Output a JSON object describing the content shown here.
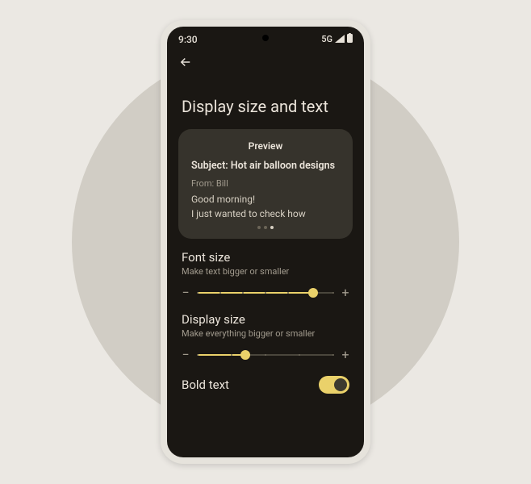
{
  "statusbar": {
    "time": "9:30",
    "network": "5G"
  },
  "page": {
    "title": "Display size and text"
  },
  "preview": {
    "label": "Preview",
    "subject": "Subject: Hot air balloon designs",
    "from": "From: Bill",
    "line1": "Good morning!",
    "line2": "I just wanted to check how"
  },
  "fontSize": {
    "title": "Font size",
    "subtitle": "Make text bigger or smaller",
    "minus": "−",
    "plus": "+",
    "valuePercent": 85
  },
  "displaySize": {
    "title": "Display size",
    "subtitle": "Make everything bigger or smaller",
    "minus": "−",
    "plus": "+",
    "valuePercent": 35
  },
  "boldText": {
    "label": "Bold text",
    "on": true
  }
}
